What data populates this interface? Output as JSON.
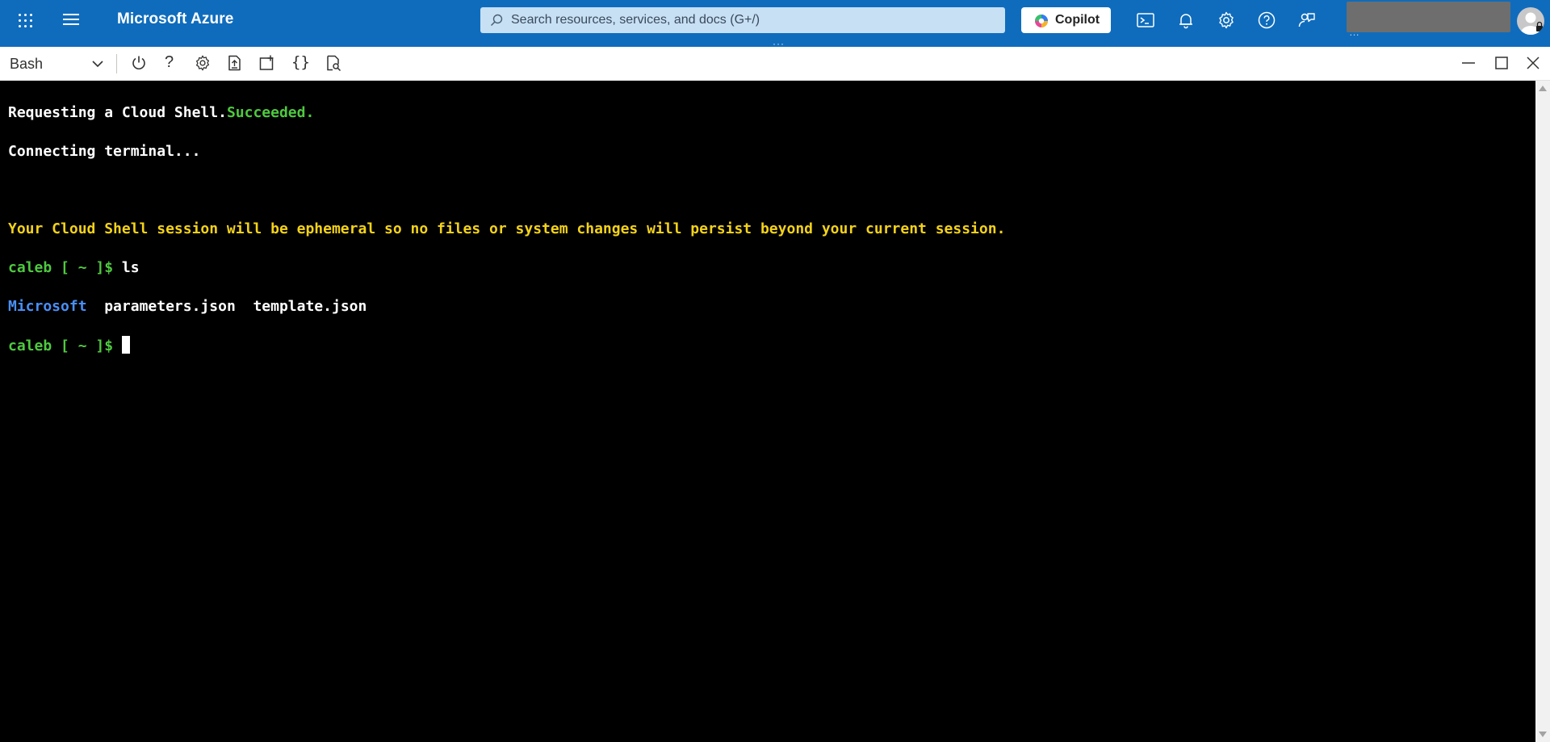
{
  "header": {
    "brand": "Microsoft Azure",
    "search_placeholder": "Search resources, services, and docs (G+/)",
    "copilot_label": "Copilot",
    "account_subtext": "…",
    "colors": {
      "bar": "#0f6cbd",
      "search_bg": "#c7e0f4"
    },
    "icons": [
      "waffle-icon",
      "hamburger-icon",
      "search-icon",
      "copilot-icon",
      "cloud-shell-icon",
      "bell-icon",
      "gear-icon",
      "help-icon",
      "feedback-icon",
      "avatar-icon"
    ]
  },
  "splitter": {
    "grip": "···"
  },
  "shell_toolbar": {
    "environment": "Bash",
    "help": "?",
    "braces": "{}",
    "icons": [
      "chevron-down-icon",
      "power-icon",
      "help-icon",
      "gear-icon",
      "upload-download-icon",
      "new-session-icon",
      "editor-braces-icon",
      "web-preview-icon",
      "minimize-icon",
      "maximize-icon",
      "close-icon"
    ]
  },
  "terminal": {
    "line1_prefix": "Requesting a Cloud Shell.",
    "line1_status": "Succeeded.",
    "line2": "Connecting terminal...",
    "line4": "Your Cloud Shell session will be ephemeral so no files or system changes will persist beyond your current session.",
    "prompt": "caleb [ ~ ]$",
    "command": "ls",
    "ls_dir": "Microsoft",
    "ls_files": "  parameters.json  template.json",
    "colors": {
      "prompt": "#4ec93f",
      "warning": "#f3d21a",
      "directory": "#4a8ff5",
      "background": "#000000"
    }
  }
}
